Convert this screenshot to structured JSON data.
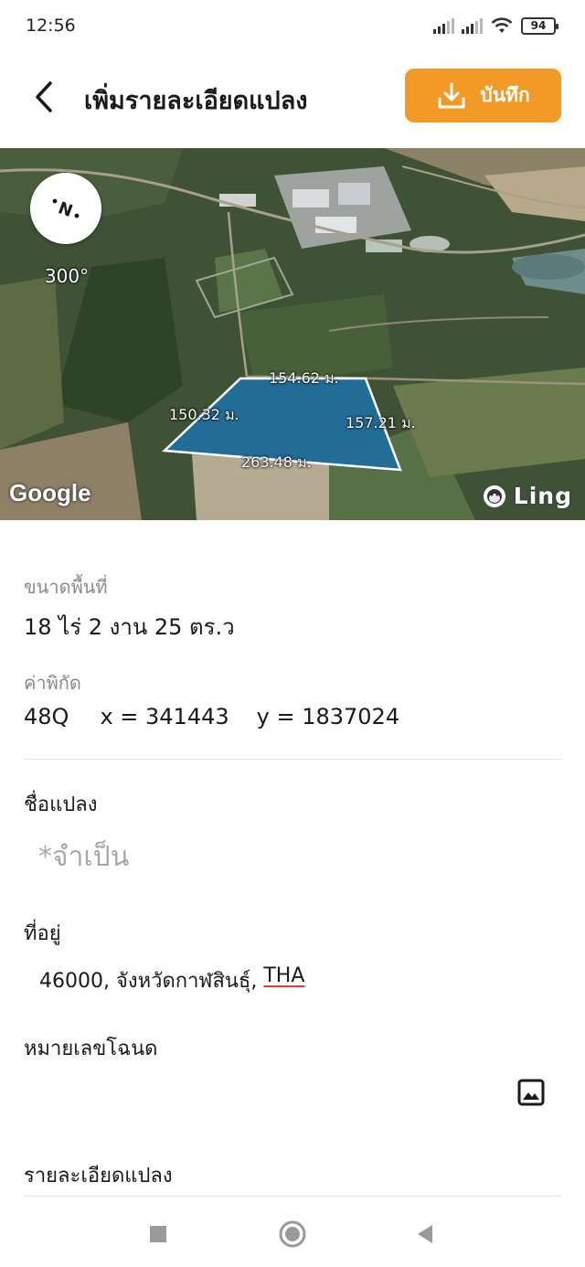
{
  "status_bar": {
    "time": "12:56",
    "battery_level": "94",
    "icons": [
      "signal-icon",
      "signal-icon",
      "wifi-icon",
      "battery-icon"
    ]
  },
  "header": {
    "title": "เพิ่มรายละเอียดแปลง",
    "back_icon": "chevron-left-icon",
    "save_label": "บันทึก",
    "save_icon": "download-icon",
    "accent_color": "#f39a26"
  },
  "map": {
    "heading": "300°",
    "compass_icon": "compass-icon",
    "edges": {
      "top": "154.62 ม.",
      "left": "150.32 ม.",
      "right": "157.21 ม.",
      "bottom": "263.48 ม."
    },
    "google_logo": "Google",
    "ling_logo": "Ling",
    "polygon_color": "#1f6fa3"
  },
  "area": {
    "caption": "ขนาดพื้นที่",
    "value": "18 ไร่ 2 งาน 25 ตร.ว"
  },
  "coordinates": {
    "caption": "ค่าพิกัด",
    "zone": "48Q",
    "x_label": "x = 341443",
    "y_label": "y = 1837024"
  },
  "plot_name": {
    "label": "ชื่อแปลง",
    "placeholder": "*จำเป็น",
    "value": ""
  },
  "address": {
    "label": "ที่อยู่",
    "value_prefix": "46000, จังหวัดกาฬสินธุ์, ",
    "country": "THA"
  },
  "deed": {
    "label": "หมายเลขโฉนด",
    "image_icon": "image-icon"
  },
  "details": {
    "label": "รายละเอียดแปลง"
  },
  "nav_bar": {
    "items": [
      "square-icon",
      "home-circle-icon",
      "back-triangle-icon"
    ]
  }
}
